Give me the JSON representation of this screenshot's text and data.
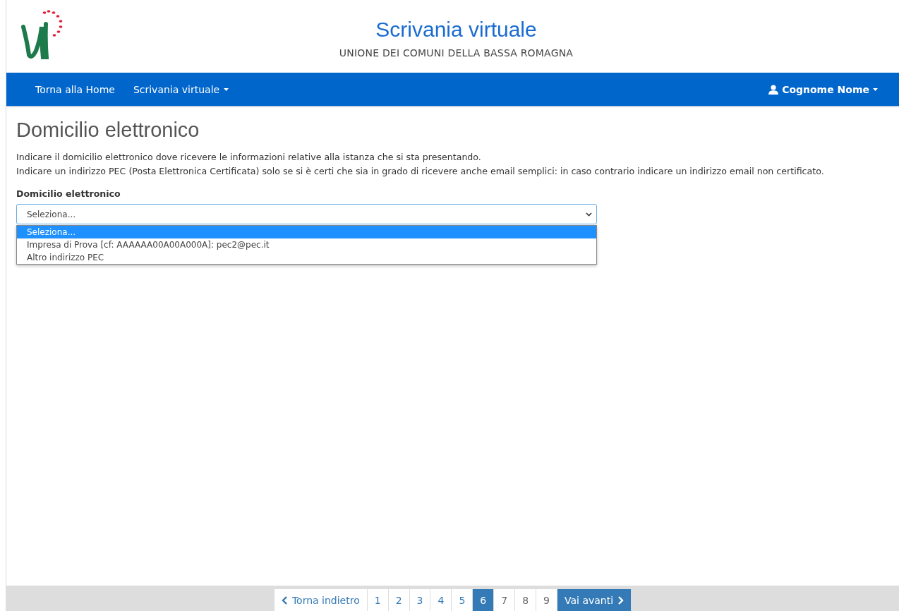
{
  "header": {
    "title": "Scrivania virtuale",
    "subtitle": "UNIONE DEI COMUNI DELLA BASSA ROMAGNA"
  },
  "navbar": {
    "links": [
      {
        "label": "Torna alla Home",
        "dropdown": false
      },
      {
        "label": "Scrivania virtuale",
        "dropdown": true
      }
    ],
    "user": {
      "label": "Cognome Nome"
    }
  },
  "page": {
    "title": "Domicilio elettronico",
    "paragraphs": [
      "Indicare il domicilio elettronico dove ricevere le informazioni relative alla istanza che si sta presentando.",
      "Indicare un indirizzo PEC (Posta Elettronica Certificata) solo se si è certi che sia in grado di ricevere anche email semplici: in caso contrario indicare un indirizzo email non certificato."
    ]
  },
  "field": {
    "label": "Domicilio elettronico",
    "value": "Seleziona...",
    "expanded": true,
    "options": [
      {
        "label": "Seleziona...",
        "selected": true
      },
      {
        "label": "Impresa di Prova [cf: AAAAAA00A00A000A]: pec2@pec.it",
        "selected": false
      },
      {
        "label": "Altro indirizzo PEC",
        "selected": false
      }
    ]
  },
  "pagination": {
    "prev": "Torna indietro",
    "next": "Vai avanti",
    "pages": [
      {
        "label": "1",
        "selected": false,
        "disabled": false
      },
      {
        "label": "2",
        "selected": false,
        "disabled": false
      },
      {
        "label": "3",
        "selected": false,
        "disabled": false
      },
      {
        "label": "4",
        "selected": false,
        "disabled": false
      },
      {
        "label": "5",
        "selected": false,
        "disabled": false
      },
      {
        "label": "6",
        "selected": true,
        "disabled": false
      },
      {
        "label": "7",
        "selected": false,
        "disabled": true
      },
      {
        "label": "8",
        "selected": false,
        "disabled": true
      },
      {
        "label": "9",
        "selected": false,
        "disabled": true
      }
    ]
  }
}
